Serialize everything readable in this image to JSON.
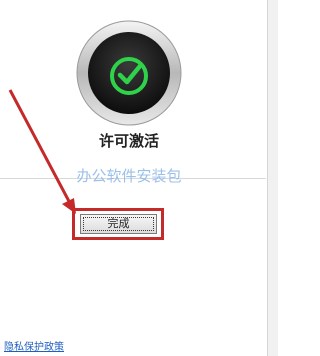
{
  "status": {
    "icon": "check-circle-icon",
    "title": "许可激活"
  },
  "watermark": {
    "text": "办公软件安装包"
  },
  "actions": {
    "finish_label": "完成"
  },
  "footer": {
    "privacy_link": "隐私保护政策"
  },
  "colors": {
    "accent_green": "#2fd34a",
    "highlight_red": "#c42a2a",
    "link_blue": "#1f5fbf"
  }
}
